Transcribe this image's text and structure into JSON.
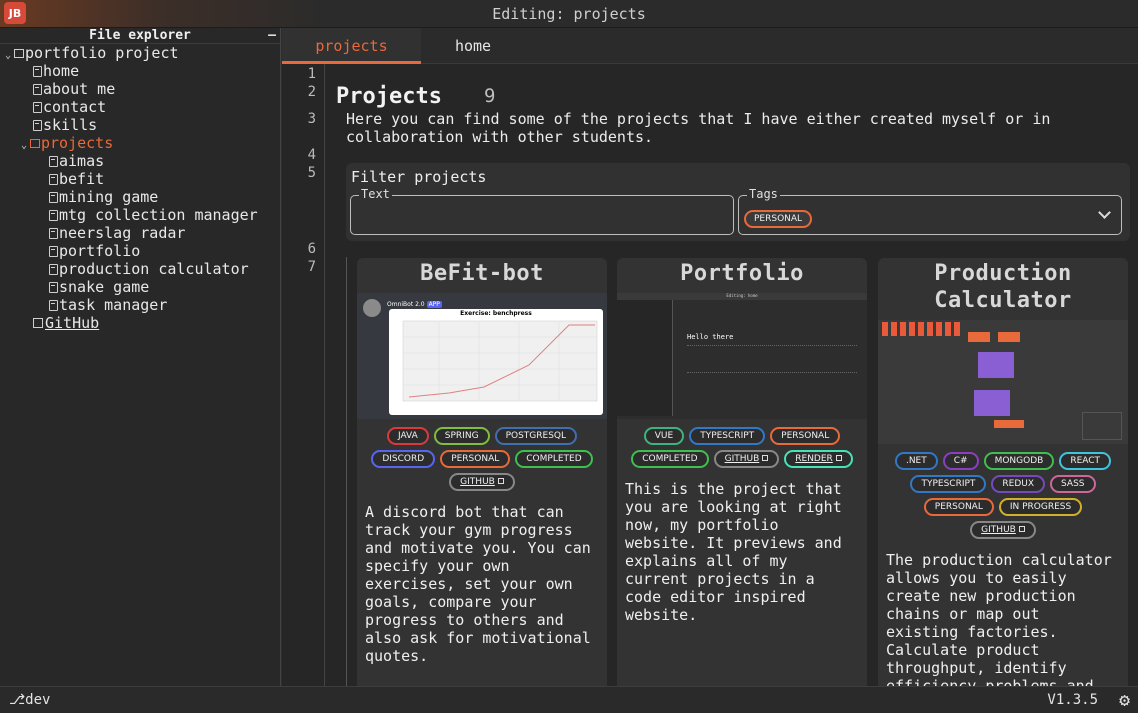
{
  "app": {
    "logo_text": "JB",
    "window_title": "Editing: projects"
  },
  "sidebar": {
    "title": "File explorer",
    "collapse_label": "–",
    "root": "portfolio project",
    "files": [
      "home",
      "about me",
      "contact",
      "skills"
    ],
    "projects_folder": "projects",
    "project_files": [
      "aimas",
      "befit",
      "mining game",
      "mtg collection manager",
      "neerslag radar",
      "portfolio",
      "production calculator",
      "snake game",
      "task manager"
    ],
    "github_link": "GitHub"
  },
  "tabs": [
    {
      "label": "projects",
      "active": true
    },
    {
      "label": "home",
      "active": false
    }
  ],
  "editor": {
    "line_numbers": [
      "1",
      "2",
      "3",
      "4",
      "5",
      "6",
      "7"
    ],
    "title": "Projects",
    "count": "9",
    "intro_line1": "Here you can find some of the projects that I have either created myself or in",
    "intro_line2": "collaboration with other students.",
    "filter": {
      "title": "Filter projects",
      "text_label": "Text",
      "text_value": "",
      "tags_label": "Tags",
      "selected_tag": "PERSONAL"
    }
  },
  "cards": [
    {
      "title": "BeFit-bot",
      "badges": [
        {
          "label": "JAVA",
          "color": "#d93b3b"
        },
        {
          "label": "SPRING",
          "color": "#7fbf3f"
        },
        {
          "label": "POSTGRESQL",
          "color": "#3f6fae"
        },
        {
          "label": "DISCORD",
          "color": "#5865f2"
        },
        {
          "label": "PERSONAL",
          "color": "#e8693a"
        },
        {
          "label": "COMPLETED",
          "color": "#3fbf4f"
        },
        {
          "label": "GITHUB",
          "color": "#888888",
          "link": true
        }
      ],
      "description": "A discord bot that can track your gym progress and motivate you. You can specify your own exercises, set your own goals, compare your progress to others and also ask for motivational quotes.",
      "preview": {
        "bot_name": "OmniBot 2.0",
        "app_badge": "APP",
        "chart_title": "Exercise: benchpress"
      }
    },
    {
      "title": "Portfolio",
      "badges": [
        {
          "label": "VUE",
          "color": "#3fb37f"
        },
        {
          "label": "TYPESCRIPT",
          "color": "#3178c6"
        },
        {
          "label": "PERSONAL",
          "color": "#e8693a"
        },
        {
          "label": "COMPLETED",
          "color": "#3fbf4f"
        },
        {
          "label": "GITHUB",
          "color": "#888888",
          "link": true
        },
        {
          "label": "RENDER",
          "color": "#46e3b7",
          "link": true
        }
      ],
      "description": "This is the project that you are looking at right now, my portfolio website. It previews and explains all of my current projects in a code editor inspired website.",
      "preview": {
        "heading": "Hello there",
        "window_title": "Editing: home"
      }
    },
    {
      "title": "Production Calculator",
      "badges": [
        {
          "label": ".NET",
          "color": "#3178c6"
        },
        {
          "label": "C#",
          "color": "#8a3fbf"
        },
        {
          "label": "MONGODB",
          "color": "#3fbf4f"
        },
        {
          "label": "REACT",
          "color": "#3fc4e0"
        },
        {
          "label": "TYPESCRIPT",
          "color": "#3178c6"
        },
        {
          "label": "REDUX",
          "color": "#764abc"
        },
        {
          "label": "SASS",
          "color": "#cd6799"
        },
        {
          "label": "PERSONAL",
          "color": "#e8693a"
        },
        {
          "label": "IN PROGRESS",
          "color": "#d4b02a"
        },
        {
          "label": "GITHUB",
          "color": "#888888",
          "link": true
        }
      ],
      "description": "The production calculator allows you to easily create new production chains or map out existing factories. Calculate product throughput, identify efficiency problems and compare recipe"
    }
  ],
  "status": {
    "branch": "dev",
    "version": "V1.3.5"
  }
}
